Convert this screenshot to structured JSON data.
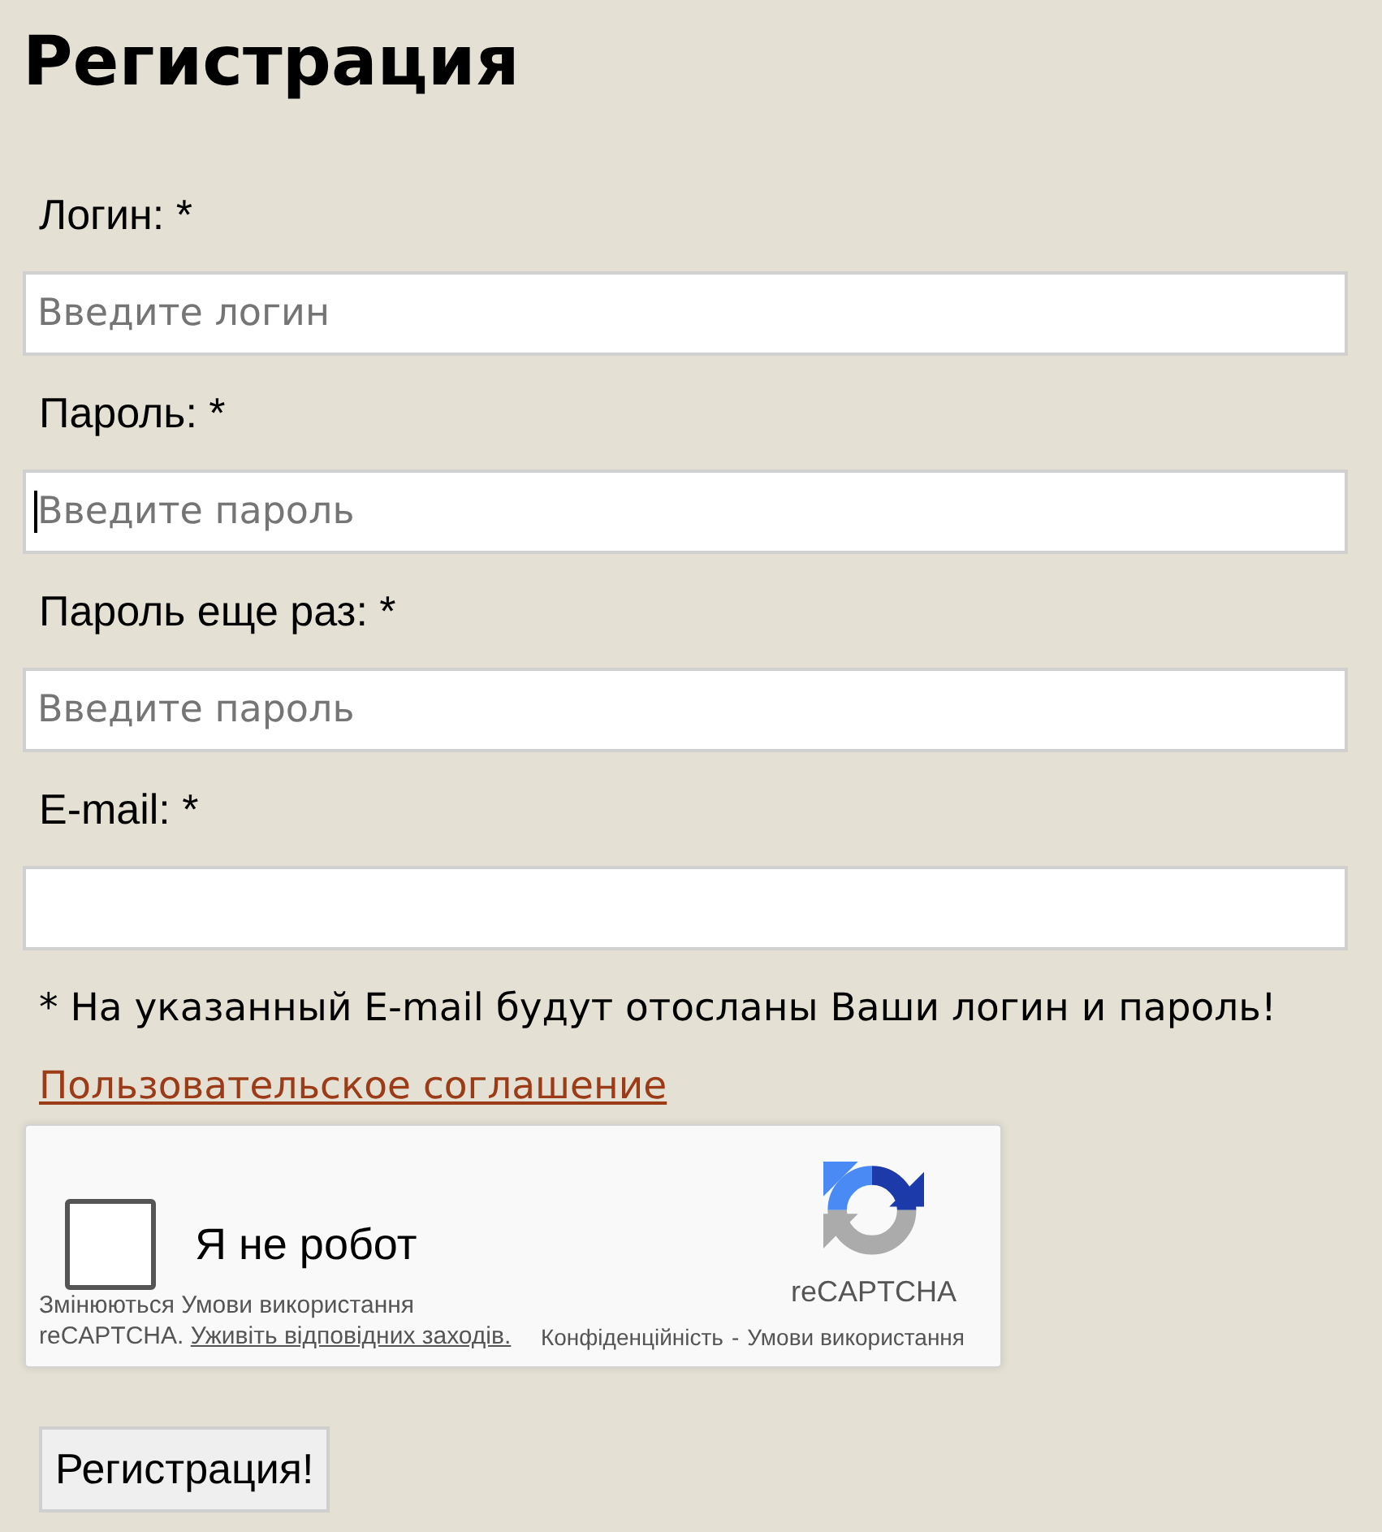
{
  "title": "Регистрация",
  "fields": [
    {
      "label": "Логин: *",
      "placeholder": "Введите логин",
      "focused": false
    },
    {
      "label": "Пароль: *",
      "placeholder": "Введите пароль",
      "focused": true
    },
    {
      "label": "Пароль еще раз: *",
      "placeholder": "Введите пароль",
      "focused": false
    },
    {
      "label": "E-mail: *",
      "focused": false
    }
  ],
  "note": "* На указанный E-mail будут отосланы Ваши логин и пароль!",
  "agreement_link": "Пользовательское соглашение",
  "captcha": {
    "checked": false,
    "label": "Я не робот",
    "notice": "Змінюються Умови використання reCAPTCHA.",
    "notice_link": "Уживіть відповідних заходів.",
    "brand": "reCAPTCHA",
    "privacy_link": "Конфіденційність",
    "separator": "-",
    "terms_link": "Умови використання"
  },
  "submit_button": "Регистрация!"
}
